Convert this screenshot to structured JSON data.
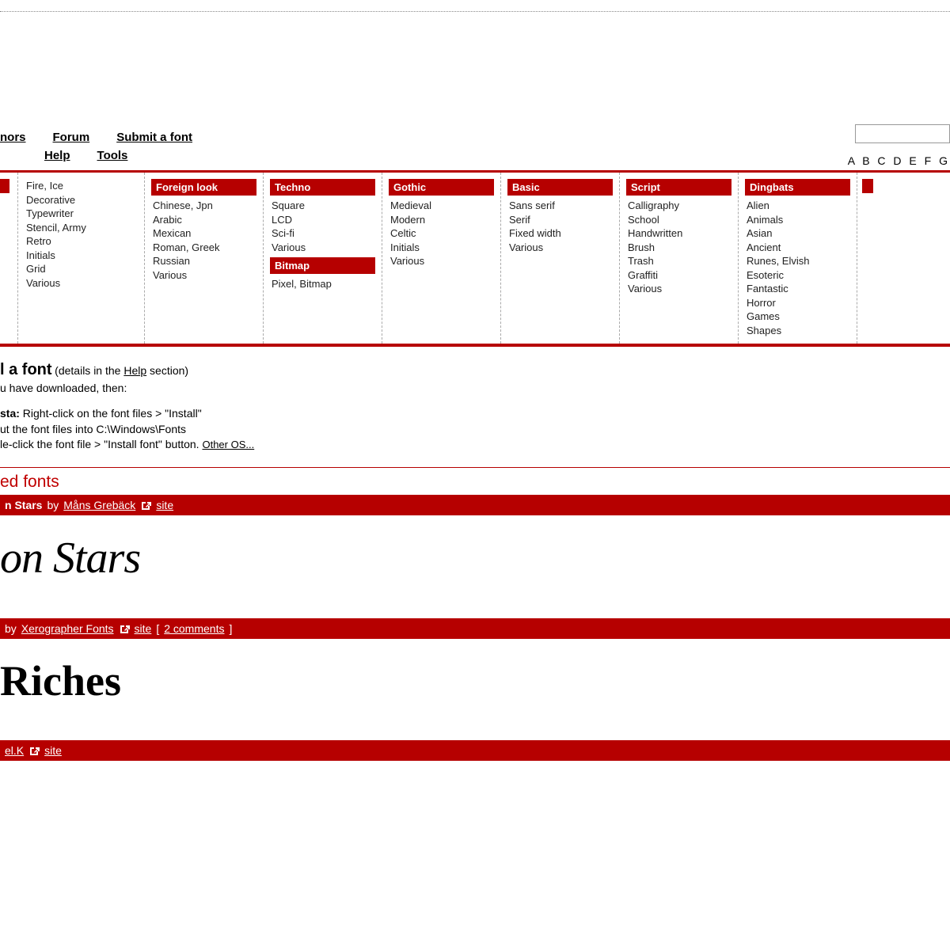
{
  "nav": {
    "line1": [
      "nors",
      "Forum",
      "Submit a font"
    ],
    "line2": [
      "Help",
      "Tools"
    ]
  },
  "alpha": "A B C D E F G",
  "categories": [
    {
      "header": null,
      "items": [
        "Fire, Ice",
        "Decorative",
        "Typewriter",
        "Stencil, Army",
        "Retro",
        "Initials",
        "Grid",
        "Various"
      ]
    },
    {
      "header": "Foreign look",
      "items": [
        "Chinese, Jpn",
        "Arabic",
        "Mexican",
        "Roman, Greek",
        "Russian",
        "Various"
      ]
    },
    {
      "header": "Techno",
      "items": [
        "Square",
        "LCD",
        "Sci-fi",
        "Various"
      ],
      "header2": "Bitmap",
      "items2": [
        "Pixel, Bitmap"
      ]
    },
    {
      "header": "Gothic",
      "items": [
        "Medieval",
        "Modern",
        "Celtic",
        "Initials",
        "Various"
      ]
    },
    {
      "header": "Basic",
      "items": [
        "Sans serif",
        "Serif",
        "Fixed width",
        "Various"
      ]
    },
    {
      "header": "Script",
      "items": [
        "Calligraphy",
        "School",
        "Handwritten",
        "Brush",
        "Trash",
        "Graffiti",
        "Various"
      ]
    },
    {
      "header": "Dingbats",
      "items": [
        "Alien",
        "Animals",
        "Asian",
        "Ancient",
        "Runes, Elvish",
        "Esoteric",
        "Fantastic",
        "Horror",
        "Games",
        "Shapes"
      ]
    }
  ],
  "install": {
    "heading_partial": "l a font",
    "detail_prefix": " (details in the ",
    "help_link": "Help",
    "detail_suffix": " section)",
    "line1": "u have downloaded, then:",
    "win_label": "sta:",
    "win_text": " Right-click on the font files > \"Install\"",
    "xp_text": "ut the font files into C:\\Windows\\Fonts",
    "mac_text": "le-click the font file > \"Install font\" button. ",
    "other_os": "Other OS..."
  },
  "section": {
    "title": "ed fonts"
  },
  "fonts": [
    {
      "name": "n Stars",
      "by": "by",
      "author": "Måns Grebäck",
      "site": "site",
      "preview": "on Stars",
      "preview_class": "preview-script"
    },
    {
      "name": "",
      "by": "by",
      "author": "Xerographer Fonts",
      "site": "site",
      "comments": "2 comments",
      "preview": "Riches",
      "preview_class": "preview-brush"
    },
    {
      "name": "",
      "by": "",
      "author": "el.K",
      "site": "site",
      "preview": "",
      "preview_class": "preview-outline"
    }
  ]
}
